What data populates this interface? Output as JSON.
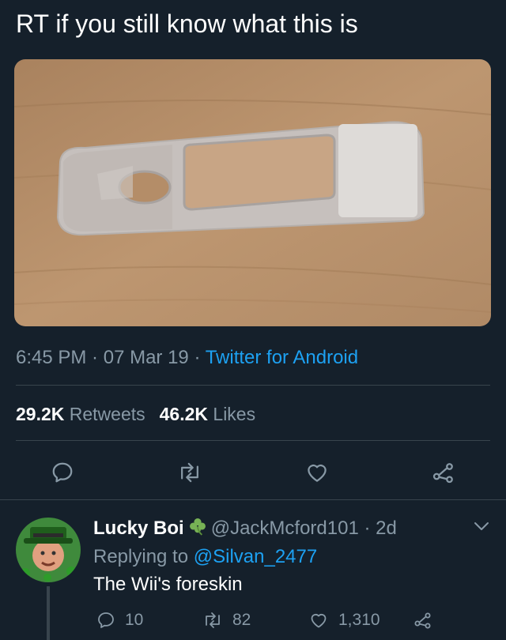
{
  "tweet": {
    "text": "RT if you still know what this is",
    "time": "6:45 PM",
    "date": "07 Mar 19",
    "sep": " · ",
    "source": "Twitter for Android",
    "retweets_count": "29.2K",
    "retweets_label": "Retweets",
    "likes_count": "46.2K",
    "likes_label": "Likes"
  },
  "actions": [
    "reply-icon",
    "retweet-icon",
    "like-icon",
    "share-icon"
  ],
  "reply": {
    "name": "Lucky Boi",
    "handle": "@JackMcford101",
    "age": " · 2d",
    "replying_prefix": "Replying to ",
    "replying_to": "@Silvan_2477",
    "text": "The Wii's foreskin",
    "reply_count": "10",
    "retweet_count": "82",
    "like_count": "1,310"
  },
  "colors": {
    "background": "#15202b",
    "secondary_text": "#8899a6",
    "link": "#1da1f2",
    "divider": "#38444d"
  }
}
